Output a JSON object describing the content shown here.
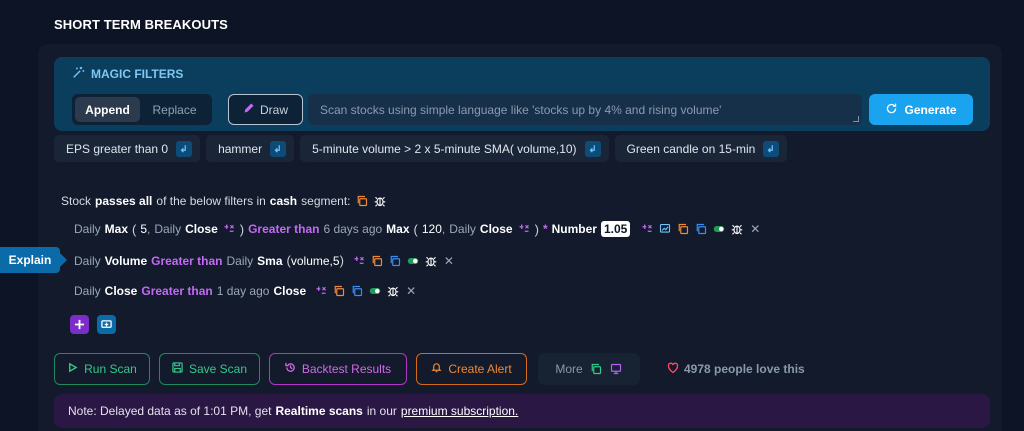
{
  "page": {
    "title": "SHORT TERM BREAKOUTS"
  },
  "magic": {
    "title": "MAGIC FILTERS",
    "mode_append": "Append",
    "mode_replace": "Replace",
    "draw_label": "Draw",
    "prompt_placeholder": "Scan stocks using simple language like 'stocks up by 4% and rising volume'",
    "generate_label": "Generate"
  },
  "chips": [
    {
      "label": "EPS greater than 0"
    },
    {
      "label": "hammer"
    },
    {
      "label": "5-minute volume > 2 x 5-minute SMA( volume,10)"
    },
    {
      "label": "Green candle on 15-min"
    }
  ],
  "scan": {
    "head_pre": "Stock",
    "head_b1": "passes all",
    "head_mid": "of the below filters in",
    "head_b2": "cash",
    "head_post": "segment:"
  },
  "rules": [
    {
      "p1": "Daily",
      "f1": "Max",
      "op": "(",
      "a1": "5",
      "c1": ",",
      "p2": "Daily",
      "f2": "Close",
      "cp": ")",
      "cmp": "Greater than",
      "offset": "6 days ago",
      "f3": "Max",
      "op2": "(",
      "a2": "120",
      "c2": ",",
      "p3": "Daily",
      "f4": "Close",
      "cp2": ")",
      "mul": "*",
      "num_label": "Number",
      "num_val": "1.05"
    },
    {
      "p1": "Daily",
      "f1": "Volume",
      "cmp": "Greater than",
      "p2": "Daily",
      "f2": "Sma",
      "op": "(",
      "a1": "volume,5",
      "cp": ")"
    },
    {
      "p1": "Daily",
      "f1": "Close",
      "cmp": "Greater than",
      "offset": "1 day ago",
      "f2": "Close"
    }
  ],
  "explain_label": "Explain",
  "actions": {
    "run": "Run Scan",
    "save": "Save Scan",
    "backtest": "Backtest Results",
    "alert": "Create Alert",
    "more": "More",
    "love": "4978 people love this"
  },
  "note": {
    "pre": "Note: Delayed data as of 1:01 PM, get",
    "bold": "Realtime scans",
    "mid": "in our",
    "link": "premium subscription."
  },
  "colors": {
    "accent": "#1aa3ef",
    "purple": "#c36af5",
    "green": "#35c98b",
    "orange": "#ef8a35"
  }
}
